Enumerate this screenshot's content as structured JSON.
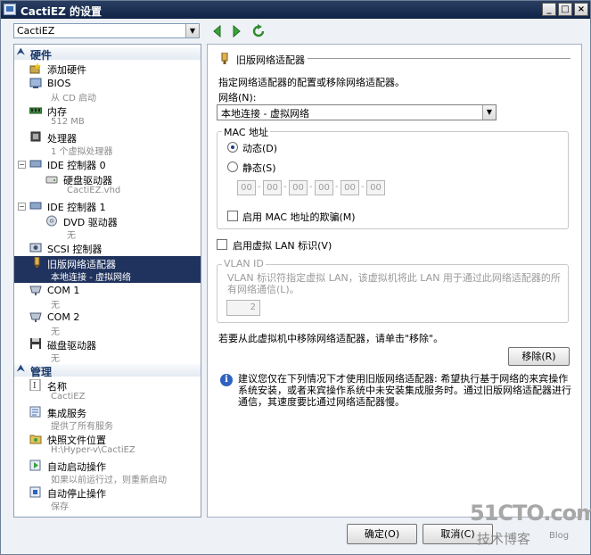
{
  "window": {
    "title": "CactiEZ 的设置"
  },
  "titlebar_controls": {
    "minimize": "_",
    "maximize": "□",
    "close": "×"
  },
  "vm_select": {
    "value": "CactiEZ"
  },
  "tree": {
    "hardware_header": "硬件",
    "management_header": "管理",
    "hardware_items": [
      {
        "label": "添加硬件",
        "sub": ""
      },
      {
        "label": "BIOS",
        "sub": "从 CD 启动"
      },
      {
        "label": "内存",
        "sub": "512 MB"
      },
      {
        "label": "处理器",
        "sub": "1 个虚拟处理器"
      },
      {
        "label": "IDE 控制器 0",
        "sub": ""
      },
      {
        "label": "硬盘驱动器",
        "sub": "CactiEZ.vhd"
      },
      {
        "label": "IDE 控制器 1",
        "sub": ""
      },
      {
        "label": "DVD 驱动器",
        "sub": "无"
      },
      {
        "label": "SCSI 控制器",
        "sub": ""
      },
      {
        "label": "旧版网络适配器",
        "sub": "本地连接 - 虚拟网络"
      },
      {
        "label": "COM 1",
        "sub": "无"
      },
      {
        "label": "COM 2",
        "sub": "无"
      },
      {
        "label": "磁盘驱动器",
        "sub": "无"
      }
    ],
    "management_items": [
      {
        "label": "名称",
        "sub": "CactiEZ"
      },
      {
        "label": "集成服务",
        "sub": "提供了所有服务"
      },
      {
        "label": "快照文件位置",
        "sub": "H:\\Hyper-v\\CactiEZ"
      },
      {
        "label": "自动启动操作",
        "sub": "如果以前运行过，则重新启动"
      },
      {
        "label": "自动停止操作",
        "sub": "保存"
      }
    ]
  },
  "panel": {
    "title": "旧版网络适配器",
    "description": "指定网络适配器的配置或移除网络适配器。",
    "network_label": "网络(N):",
    "network_value": "本地连接 - 虚拟网络",
    "mac_group": "MAC 地址",
    "dynamic_label": "动态(D)",
    "static_label": "静态(S)",
    "mac_octets": [
      "00",
      "00",
      "00",
      "00",
      "00",
      "00"
    ],
    "mac_sep": "-",
    "spoof_label": "启用 MAC 地址的欺骗(M)",
    "vlan_enable_label": "启用虚拟 LAN 标识(V)",
    "vlan_group": "VLAN ID",
    "vlan_desc": "VLAN 标识符指定虚拟 LAN，该虚拟机将此 LAN 用于通过此网络适配器的所有网络通信(L)。",
    "vlan_value": "2",
    "remove_text": "若要从此虚拟机中移除网络适配器，请单击\"移除\"。",
    "remove_button": "移除(R)",
    "info_text": "建议您仅在下列情况下才使用旧版网络适配器: 希望执行基于网络的来宾操作系统安装，或者来宾操作系统中未安装集成服务时。通过旧版网络适配器进行通信，其速度要比通过网络适配器慢。"
  },
  "buttons": {
    "ok": "确定(O)",
    "cancel": "取消(C)"
  },
  "watermark": {
    "main": "51CTO.com",
    "sub": "技术博客",
    "tag": "Blog"
  },
  "colors": {
    "titlebar": "#1a2d52",
    "selected": "#20335e",
    "accent_green": "#3aa33a"
  }
}
